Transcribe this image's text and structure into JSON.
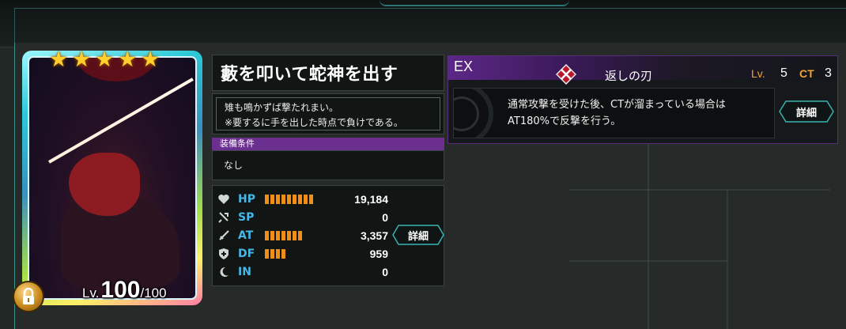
{
  "card": {
    "stars": [
      "★",
      "★",
      "★",
      "★",
      "★"
    ],
    "level_label": "Lv.",
    "level": "100",
    "level_max": "/100"
  },
  "equipment": {
    "name": "藪を叩いて蛇神を出す",
    "flavor_line1": "雉も鳴かずば撃たれまい。",
    "flavor_line2": "※要するに手を出した時点で負けである。",
    "condition_header": "装備条件",
    "condition_value": "なし"
  },
  "stats": [
    {
      "name": "HP",
      "value": "19,184",
      "bar": 9,
      "icon": "heart-icon"
    },
    {
      "name": "SP",
      "value": "0",
      "bar": 0,
      "icon": "sp-icon"
    },
    {
      "name": "AT",
      "value": "3,357",
      "bar": 7,
      "icon": "sword-icon"
    },
    {
      "name": "DF",
      "value": "959",
      "bar": 4,
      "icon": "shield-icon"
    },
    {
      "name": "IN",
      "value": "0",
      "bar": 0,
      "icon": "moon-icon"
    }
  ],
  "stats_detail_label": "詳細",
  "ex_skill": {
    "tag": "EX",
    "name": "返しの刃",
    "lv_label": "Lv.",
    "lv": "5",
    "ct_label": "CT",
    "ct": "3",
    "desc_line1": "通常攻撃を受けた後、CTが溜まっている場合は",
    "desc_line2": "AT180%で反撃を行う。",
    "detail_label": "詳細"
  },
  "colors": {
    "accent_teal": "#3ab3b0",
    "purple": "#6b2f8f",
    "stat_name": "#46b8e8",
    "bar_orange": "#ef8f18",
    "label_orange": "#f0a332"
  }
}
